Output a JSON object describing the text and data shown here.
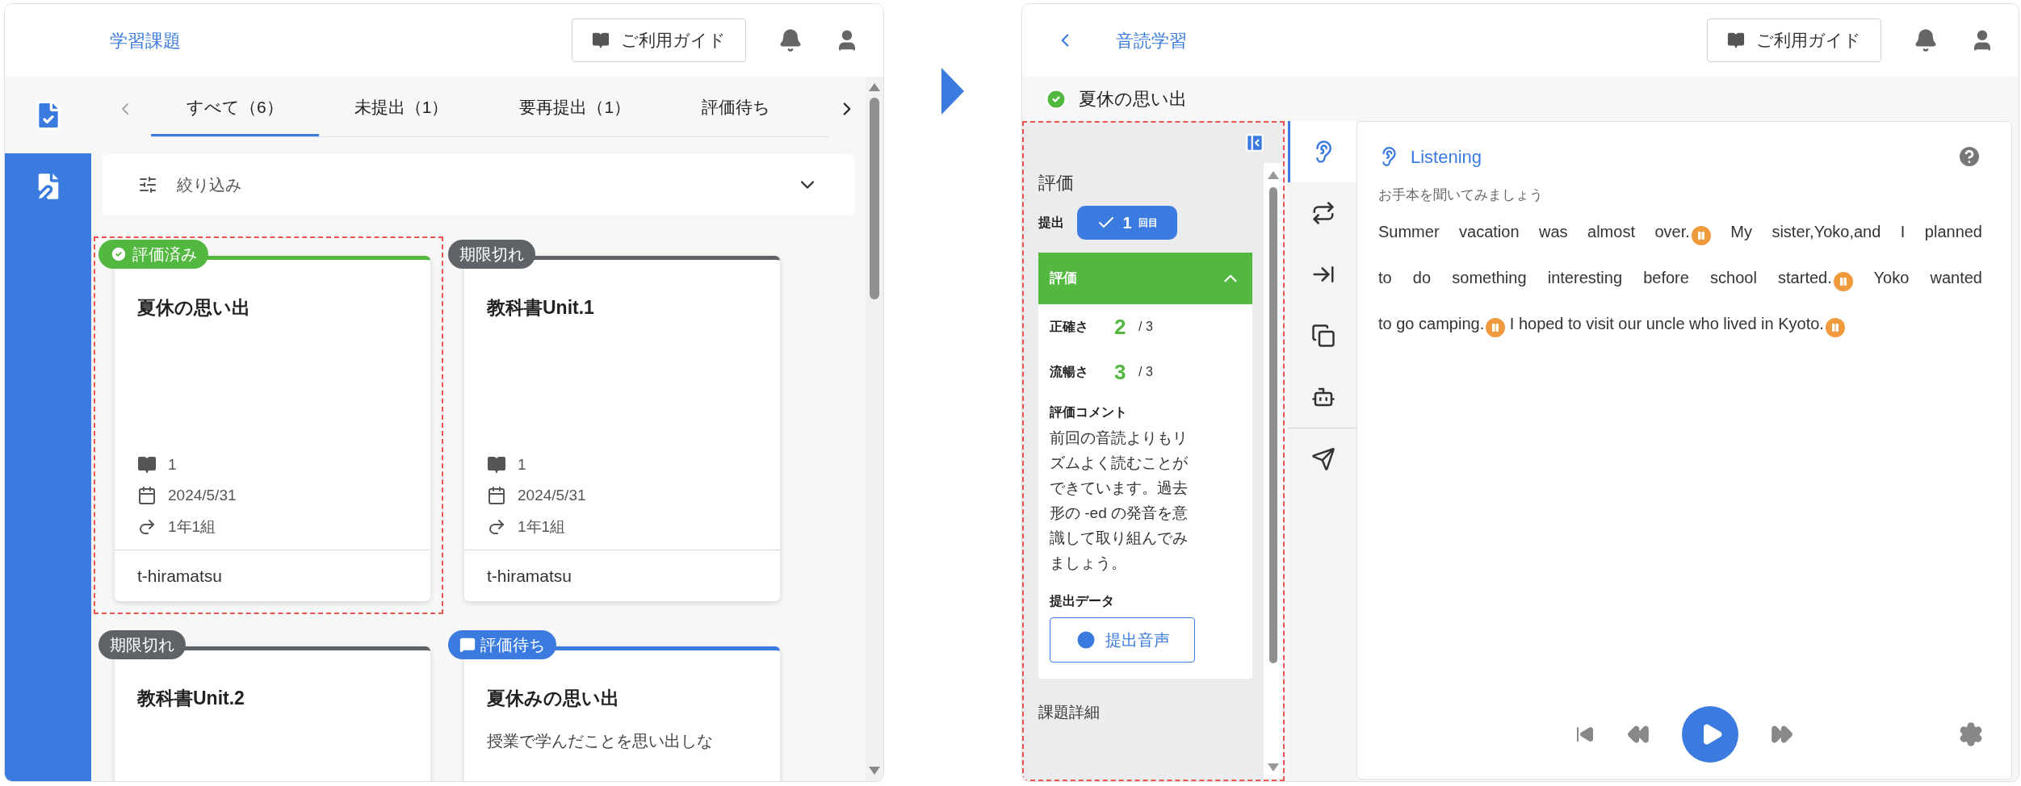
{
  "left_screen": {
    "header": {
      "title": "学習課題",
      "guide_button": "ご利用ガイド"
    },
    "tabs": [
      {
        "label": "すべて（6）",
        "selected": true
      },
      {
        "label": "未提出（1）",
        "selected": false
      },
      {
        "label": "要再提出（1）",
        "selected": false
      },
      {
        "label": "評価待ち",
        "selected": false
      }
    ],
    "filter": {
      "label": "絞り込み",
      "expanded": false
    },
    "cards": [
      {
        "kind": "graded",
        "status": "評価済み",
        "title": "夏休の思い出",
        "highlighted": true,
        "unit": "1",
        "date": "2024/5/31",
        "class": "1年1組",
        "teacher": "t-hiramatsu"
      },
      {
        "kind": "expired",
        "status": "期限切れ",
        "title": "教科書Unit.1",
        "highlighted": false,
        "unit": "1",
        "date": "2024/5/31",
        "class": "1年1組",
        "teacher": "t-hiramatsu"
      },
      {
        "kind": "expired",
        "status": "期限切れ",
        "title": "教科書Unit.2",
        "highlighted": false
      },
      {
        "kind": "pending",
        "status": "評価待ち",
        "title": "夏休みの思い出",
        "highlighted": false,
        "description": "授業で学んだことを思い出しな"
      }
    ]
  },
  "right_screen": {
    "header": {
      "title": "音読学習",
      "guide_button": "ご利用ガイド"
    },
    "assignment_title": "夏休の思い出",
    "evaluation_panel": {
      "highlighted": true,
      "heading": "評価",
      "submission_label": "提出",
      "submission_count": "1",
      "submission_unit": "回目",
      "section_title": "評価",
      "expanded": true,
      "scores": [
        {
          "label": "正確さ",
          "value": "2",
          "max": "/ 3"
        },
        {
          "label": "流暢さ",
          "value": "3",
          "max": "/ 3"
        }
      ],
      "comment_label": "評価コメント",
      "comment": "前回の音読よりもリズムよく読むことができています。過去形の -ed の発音を意識して取り組んでみましょう。",
      "data_label": "提出データ",
      "audio_button": "提出音声",
      "details_heading": "課題詳細"
    },
    "mode_tabs": [
      {
        "kind": "listening",
        "selected": true
      },
      {
        "kind": "repeat",
        "selected": false
      },
      {
        "kind": "read",
        "selected": false
      },
      {
        "kind": "overlap",
        "selected": false
      },
      {
        "kind": "ai",
        "selected": false
      },
      {
        "kind": "submit",
        "selected": false
      }
    ],
    "content": {
      "mode": "Listening",
      "instruction": "お手本を聞いてみましょう",
      "lines": [
        [
          {
            "text": "Summer vacation was almost over.",
            "pause": true
          },
          {
            "text": "My sister,Yoko,and I planned",
            "pause": false
          }
        ],
        [
          {
            "text": "to do something interesting before school started.",
            "pause": true
          },
          {
            "text": "Yoko wanted",
            "pause": false
          }
        ],
        [
          {
            "text": "to go camping.",
            "pause": true
          },
          {
            "text": "I hoped to visit our uncle who lived in Kyoto.",
            "pause": true
          }
        ]
      ]
    }
  }
}
